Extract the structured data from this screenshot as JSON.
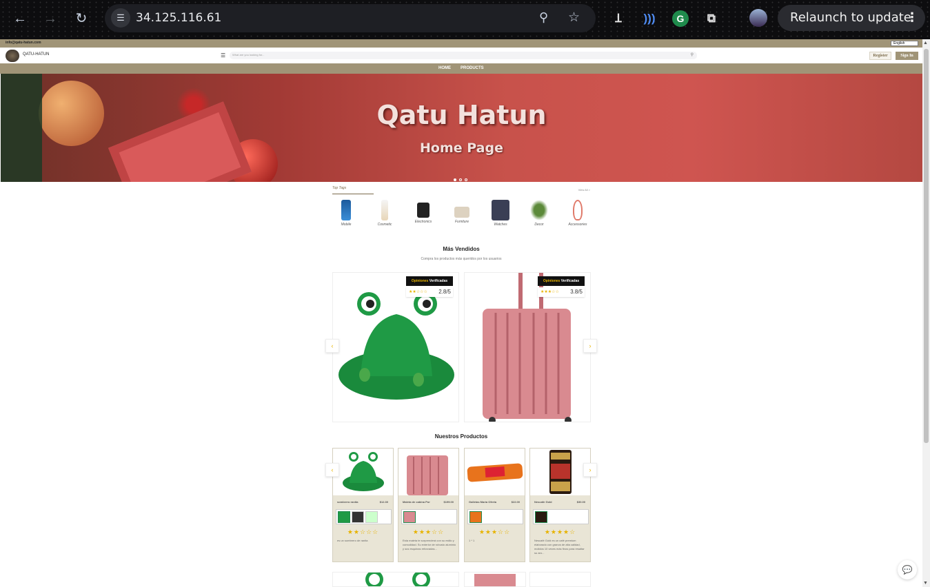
{
  "browser": {
    "url": "34.125.116.61",
    "relaunch_label": "Relaunch to update",
    "extensions": [
      "translate-extension-icon",
      "wifi-extension-icon",
      "grammarly-icon",
      "puzzle-extensions-icon"
    ]
  },
  "site": {
    "email": "info@qatu-hatun.com",
    "language": "English",
    "brand": "QATU-HATUN",
    "search_placeholder": "What are you looking for...",
    "register_label": "Register",
    "signin_label": "Sign In",
    "nav": [
      "HOME",
      "PRODUCTS"
    ],
    "colors": {
      "accent": "#a09477",
      "star": "#e7b300"
    }
  },
  "hero": {
    "title": "Qatu Hatun",
    "subtitle": "Home Page",
    "slides": 3,
    "active_slide": 1
  },
  "top_tags": {
    "title": "Top Tags",
    "view_all": "View All >",
    "items": [
      {
        "label": "Mobile"
      },
      {
        "label": "Cosmetic"
      },
      {
        "label": "Electronics"
      },
      {
        "label": "Furniture"
      },
      {
        "label": "Watches"
      },
      {
        "label": "Decor"
      },
      {
        "label": "Accessories"
      }
    ]
  },
  "best_sellers": {
    "title": "Más Vendidos",
    "subtitle": "Compra los productos más queridos por los usuarios",
    "badge_a": "Opiniones",
    "badge_b": "Verificadas",
    "items": [
      {
        "rating": "2.8/5",
        "stars": "★★☆☆☆"
      },
      {
        "rating": "3.8/5",
        "stars": "★★★☆☆"
      }
    ]
  },
  "our_products": {
    "title": "Nuestros Productos",
    "items": [
      {
        "name": "sombrero ranita",
        "price": "$12.30",
        "stars": "★★☆☆☆",
        "desc": "es un sombrero de ranita"
      },
      {
        "name": "Maleta de cabina Por",
        "price": "$199.00",
        "stars": "★★★☆☆",
        "desc": "Esta maleta te sorprenderá con su estilo y comodidad. Su exterior de robusto aluminio y sus esquinas reforzadas..."
      },
      {
        "name": "Galletas María Oferta",
        "price": "$22.00",
        "stars": "★★★☆☆",
        "desc": "1 * 1"
      },
      {
        "name": "Nescafe Gold",
        "price": "$30.00",
        "stars": "★★★★☆",
        "desc": "Nescafé Gold es un café premium elaborado con granos de alta calidad, molidos 10 veces más finos para resaltar su aro..."
      }
    ]
  }
}
